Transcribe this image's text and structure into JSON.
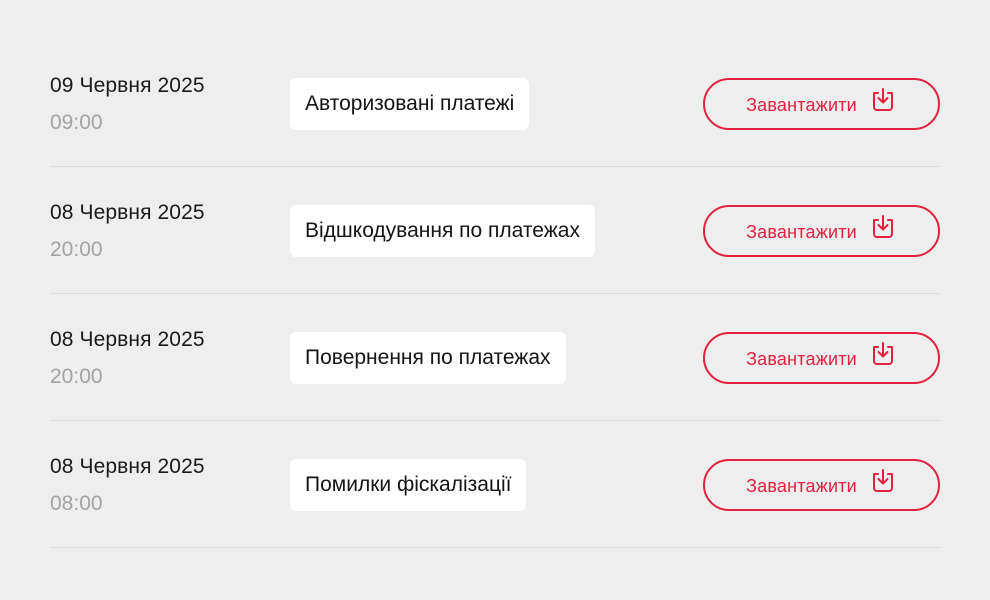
{
  "reports": [
    {
      "date": "09 Червня 2025",
      "time": "09:00",
      "title": "Авторизовані платежі",
      "button_label": "Завантажити",
      "icon": "download-icon"
    },
    {
      "date": "08 Червня 2025",
      "time": "20:00",
      "title": "Відшкодування по платежах",
      "button_label": "Завантажити",
      "icon": "download-icon"
    },
    {
      "date": "08 Червня 2025",
      "time": "20:00",
      "title": "Повернення по платежах",
      "button_label": "Завантажити",
      "icon": "download-icon"
    },
    {
      "date": "08 Червня 2025",
      "time": "08:00",
      "title": "Помилки фіскалізації",
      "button_label": "Завантажити",
      "icon": "download-icon"
    }
  ],
  "colors": {
    "background": "#efeeee",
    "accent": "#e0213f",
    "secondary_text": "#a3a3a3"
  }
}
